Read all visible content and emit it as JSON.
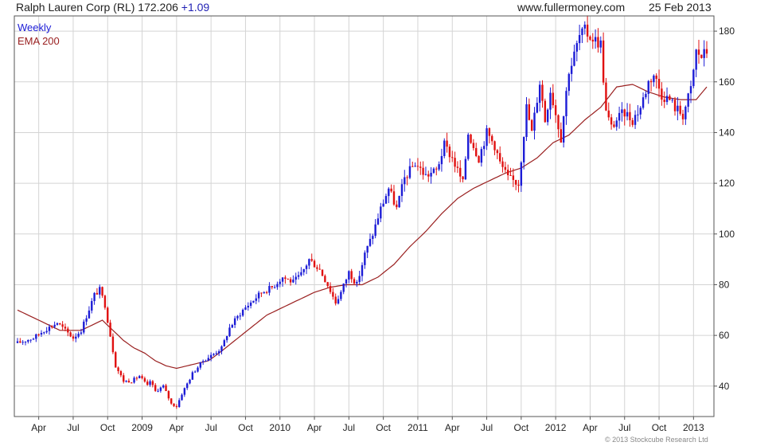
{
  "header": {
    "title": "Ralph Lauren Corp (RL) 172.206",
    "change": "+1.09",
    "website": "www.fullermoney.com",
    "date": "25 Feb 2013"
  },
  "copyright": "© 2013 Stockcube Research Ltd",
  "colors": {
    "up": "#1c1cd6",
    "down": "#e01010",
    "ema": "#9a2020",
    "grid": "#d4d4d4",
    "frame": "#555555"
  },
  "chart_data": {
    "type": "candlestick",
    "title": "Ralph Lauren Corp (RL) 172.206 +1.09",
    "legend": [
      {
        "label": "Weekly",
        "color": "#1c1cd6"
      },
      {
        "label": "EMA 200",
        "color": "#9a2020"
      }
    ],
    "legend_position": "top-left",
    "ylim": [
      28,
      186
    ],
    "y_ticks": [
      40,
      60,
      80,
      100,
      120,
      140,
      160,
      180
    ],
    "y_axis_side": "right",
    "x_ticks": [
      "Apr",
      "Jul",
      "Oct",
      "2009",
      "Apr",
      "Jul",
      "Oct",
      "2010",
      "Apr",
      "Jul",
      "Oct",
      "2011",
      "Apr",
      "Jul",
      "Oct",
      "2012",
      "Apr",
      "Jul",
      "Oct",
      "2013"
    ],
    "x_tick_weeks": [
      8,
      21,
      34,
      47,
      60,
      73,
      86,
      99,
      112,
      125,
      138,
      151,
      164,
      177,
      190,
      203,
      216,
      229,
      242,
      255
    ],
    "price_close_anchors": {
      "week": [
        0,
        6,
        10,
        15,
        21,
        24,
        29,
        31,
        33,
        37,
        40,
        43,
        46,
        49,
        50,
        52,
        55,
        58,
        60,
        62,
        66,
        70,
        73,
        77,
        80,
        82,
        85,
        88,
        92,
        96,
        100,
        104,
        107,
        110,
        114,
        117,
        120,
        122,
        125,
        128,
        131,
        134,
        137,
        140,
        143,
        146,
        150,
        154,
        158,
        161,
        164,
        168,
        170,
        174,
        177,
        180,
        182,
        185,
        189,
        192,
        194,
        197,
        199,
        201,
        205,
        208,
        209,
        212,
        214,
        216,
        220,
        222,
        224,
        226,
        229,
        232,
        235,
        238,
        240,
        243,
        246,
        248,
        251,
        254,
        256,
        258,
        260
      ],
      "close": [
        57,
        59,
        62,
        65,
        59,
        62,
        76,
        78,
        72,
        48,
        42,
        42,
        44,
        40,
        42,
        38,
        40,
        33,
        32,
        37,
        45,
        50,
        52,
        55,
        63,
        66,
        70,
        73,
        77,
        79,
        83,
        81,
        84,
        90,
        86,
        80,
        73,
        77,
        85,
        80,
        92,
        100,
        110,
        118,
        110,
        122,
        128,
        123,
        125,
        135,
        130,
        120,
        140,
        130,
        140,
        135,
        128,
        122,
        120,
        150,
        140,
        160,
        145,
        157,
        138,
        165,
        167,
        178,
        180,
        178,
        175,
        148,
        142,
        145,
        148,
        145,
        150,
        160,
        163,
        155,
        153,
        150,
        147,
        157,
        172,
        170,
        172
      ]
    },
    "ema200_anchors": {
      "week": [
        0,
        8,
        16,
        24,
        32,
        40,
        44,
        48,
        52,
        56,
        60,
        64,
        68,
        72,
        76,
        82,
        88,
        94,
        100,
        106,
        112,
        118,
        124,
        130,
        136,
        142,
        148,
        154,
        160,
        166,
        172,
        178,
        184,
        190,
        196,
        202,
        208,
        214,
        220,
        226,
        232,
        238,
        244,
        250,
        256,
        260
      ],
      "value": [
        70,
        66,
        62,
        62,
        66,
        58,
        55,
        53,
        50,
        48,
        47,
        48,
        49,
        50,
        53,
        58,
        63,
        68,
        71,
        74,
        77,
        79,
        80,
        80,
        83,
        88,
        95,
        101,
        108,
        114,
        118,
        121,
        124,
        126,
        130,
        136,
        139,
        145,
        150,
        158,
        159,
        156,
        154,
        153,
        153,
        158
      ]
    },
    "weeks": 261
  }
}
